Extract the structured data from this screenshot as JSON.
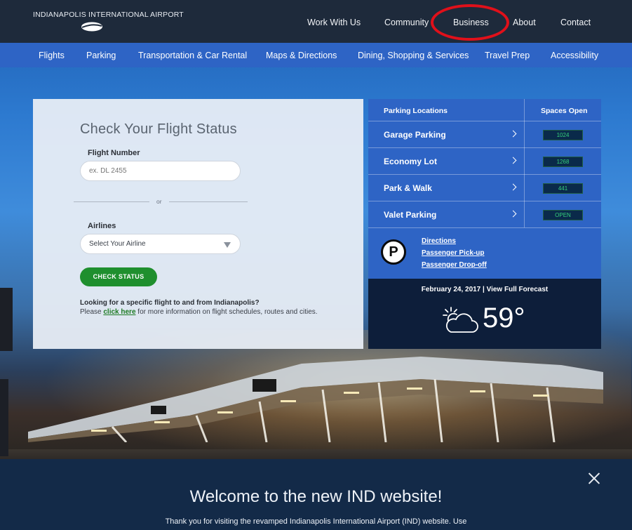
{
  "header": {
    "logo_text": "INDIANAPOLIS INTERNATIONAL AIRPORT",
    "nav": [
      "Work With Us",
      "Community",
      "Business",
      "About",
      "Contact"
    ],
    "highlight_color": "#e0101a"
  },
  "subnav": [
    "Flights",
    "Parking",
    "Transportation & Car Rental",
    "Maps & Directions",
    "Dining, Shopping & Services",
    "Travel Prep",
    "Accessibility"
  ],
  "flight_status": {
    "title": "Check Your Flight Status",
    "flight_number_label": "Flight Number",
    "flight_number_placeholder": "ex. DL 2455",
    "or_text": "or",
    "airlines_label": "Airlines",
    "airline_select_value": "Select Your Airline",
    "check_button": "CHECK STATUS",
    "desc_bold": "Looking for a specific flight to and from Indianapolis?",
    "desc_pre": "Please",
    "desc_link": "click here",
    "desc_post": "for more information on flight schedules, routes and cities."
  },
  "parking": {
    "col1": "Parking Locations",
    "col2": "Spaces Open",
    "rows": [
      {
        "name": "Garage Parking",
        "count": "1024"
      },
      {
        "name": "Economy Lot",
        "count": "1268"
      },
      {
        "name": "Park & Walk",
        "count": "441"
      },
      {
        "name": "Valet Parking",
        "count": "OPEN"
      }
    ],
    "logo_letter": "P",
    "links": [
      "Directions",
      "Passenger Pick-up",
      "Passenger Drop-off"
    ]
  },
  "weather": {
    "date_line": "February 24, 2017  |  View Full Forecast",
    "temp": "59°",
    "icon": "partly-cloudy-icon"
  },
  "welcome": {
    "title": "Welcome to the new IND website!",
    "text": "Thank you for visiting the revamped Indianapolis International Airport (IND) website. Use"
  }
}
